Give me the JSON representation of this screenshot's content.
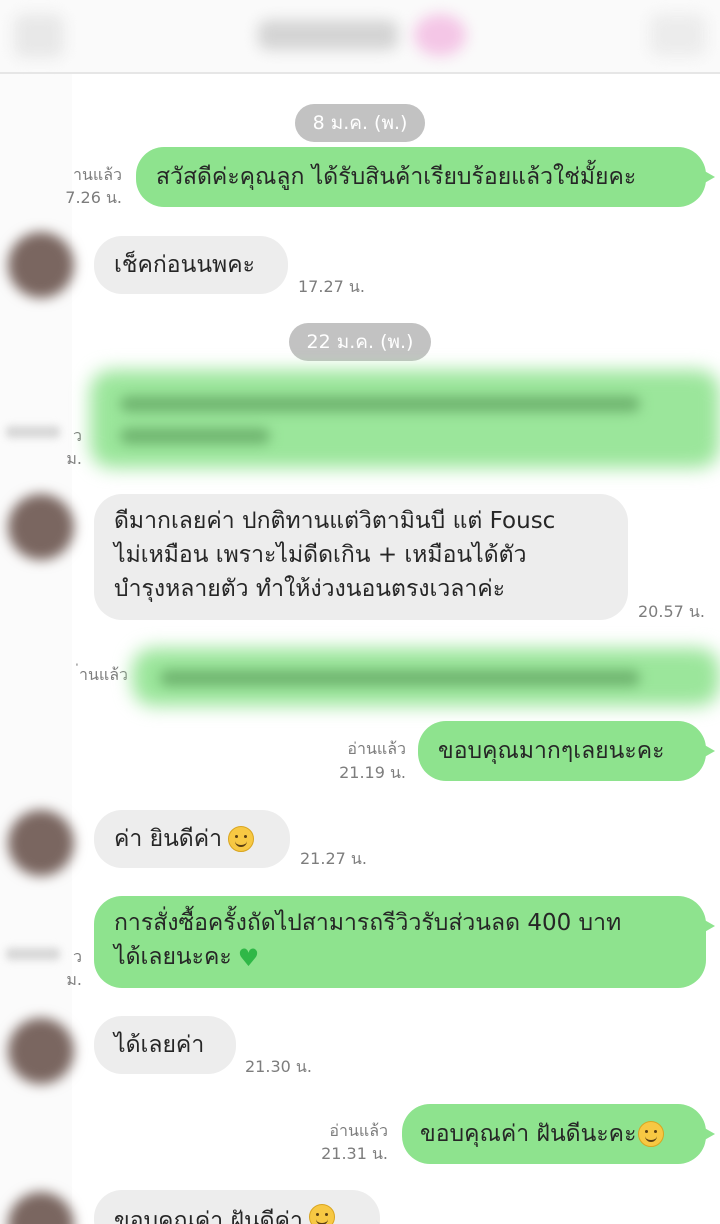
{
  "chat": {
    "dates": [
      "8 ม.ค. (พ.)",
      "22 ม.ค. (พ.)"
    ],
    "read_label": "อ่านแล้ว",
    "m1": {
      "text": "สวัสดีค่ะคุณลูก ได้รับสินค้าเรียบร้อยแล้วใช่มั้ยคะ",
      "read": "านแล้ว",
      "time": "7.26 น."
    },
    "m2": {
      "text": "เช็คก่อนนพคะ",
      "time": "17.27 น."
    },
    "m3": {
      "read": "ว",
      "time": "ม."
    },
    "m4": {
      "lines": [
        "ดีมากเลยค่า ปกติทานแต่วิตามินบี แต่ Fousc",
        "ไม่เหมือน เพราะไม่ดีดเกิน + เหมือนได้ตัว",
        "บำรุงหลายตัว ทำให้ง่วงนอนตรงเวลาค่ะ"
      ],
      "time": "20.57 น."
    },
    "m5": {
      "read": "่านแล้ว"
    },
    "m6": {
      "text": "ขอบคุณมากๆเลยนะคะ",
      "time": "21.19 น."
    },
    "m7": {
      "text": "ค่า ยินดีค่า",
      "time": "21.27 น."
    },
    "m8": {
      "lines": [
        "การสั่งซื้อครั้งถัดไปสามารถรีวิวรับส่วนลด 400 บาท",
        "ได้เลยนะคะ"
      ],
      "read": "ว",
      "time": "ม."
    },
    "m9": {
      "text": "ได้เลยค่า",
      "time": "21.30 น."
    },
    "m10": {
      "text": "ขอบคุณค่า ฝันดีนะคะ",
      "time": "21.31 น."
    },
    "m11": {
      "text": "ขอบคุณค่า ฝันดีค่า"
    }
  },
  "emoji": {
    "smile": "smiling-face-emoji",
    "heart": "green-heart-emoji"
  },
  "colors": {
    "outgoing_bubble": "#8ee38e",
    "incoming_bubble": "#ededed",
    "date_pill": "#c2c2c2"
  }
}
